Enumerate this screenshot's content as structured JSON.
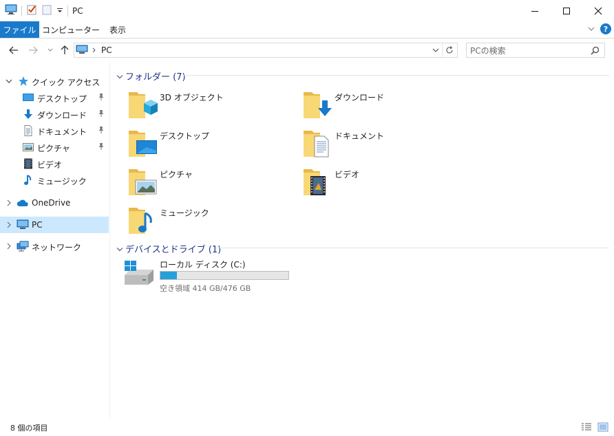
{
  "titlebar": {
    "title": "PC",
    "quick_access": [
      "pc-icon",
      "properties-icon",
      "new-folder-icon",
      "customize-dropdown-icon"
    ],
    "buttons": [
      "minimize",
      "maximize",
      "close"
    ]
  },
  "ribbon": {
    "tabs": [
      {
        "label": "ファイル",
        "active": true
      },
      {
        "label": "コンピューター"
      },
      {
        "label": "表示"
      }
    ],
    "accent_color": "#1979ca"
  },
  "navbar": {
    "breadcrumb": [
      "PC"
    ],
    "search_placeholder": "PCの検索"
  },
  "sidebar": {
    "quick_access_label": "クイック アクセス",
    "quick_items": [
      {
        "label": "デスクトップ",
        "icon": "desktop-icon",
        "pinned": true
      },
      {
        "label": "ダウンロード",
        "icon": "download-icon",
        "pinned": true
      },
      {
        "label": "ドキュメント",
        "icon": "document-icon",
        "pinned": true
      },
      {
        "label": "ピクチャ",
        "icon": "picture-icon",
        "pinned": true
      },
      {
        "label": "ビデオ",
        "icon": "video-icon",
        "pinned": false
      },
      {
        "label": "ミュージック",
        "icon": "music-icon",
        "pinned": false
      }
    ],
    "onedrive_label": "OneDrive",
    "pc_label": "PC",
    "network_label": "ネットワーク",
    "selected": "PC"
  },
  "content": {
    "folders_header": "フォルダー (7)",
    "folders": [
      {
        "label": "3D オブジェクト",
        "icon": "3d-objects-icon"
      },
      {
        "label": "ダウンロード",
        "icon": "download-icon"
      },
      {
        "label": "デスクトップ",
        "icon": "desktop-icon"
      },
      {
        "label": "ドキュメント",
        "icon": "document-icon"
      },
      {
        "label": "ピクチャ",
        "icon": "picture-icon"
      },
      {
        "label": "ビデオ",
        "icon": "video-icon"
      },
      {
        "label": "ミュージック",
        "icon": "music-icon"
      }
    ],
    "drives_header": "デバイスとドライブ (1)",
    "drive": {
      "label": "ローカル ディスク (C:)",
      "free_text": "空き領域 414 GB/476 GB",
      "used_fraction": 0.13,
      "bar_color": "#26a0da"
    }
  },
  "status": {
    "item_count": "8 個の項目"
  }
}
